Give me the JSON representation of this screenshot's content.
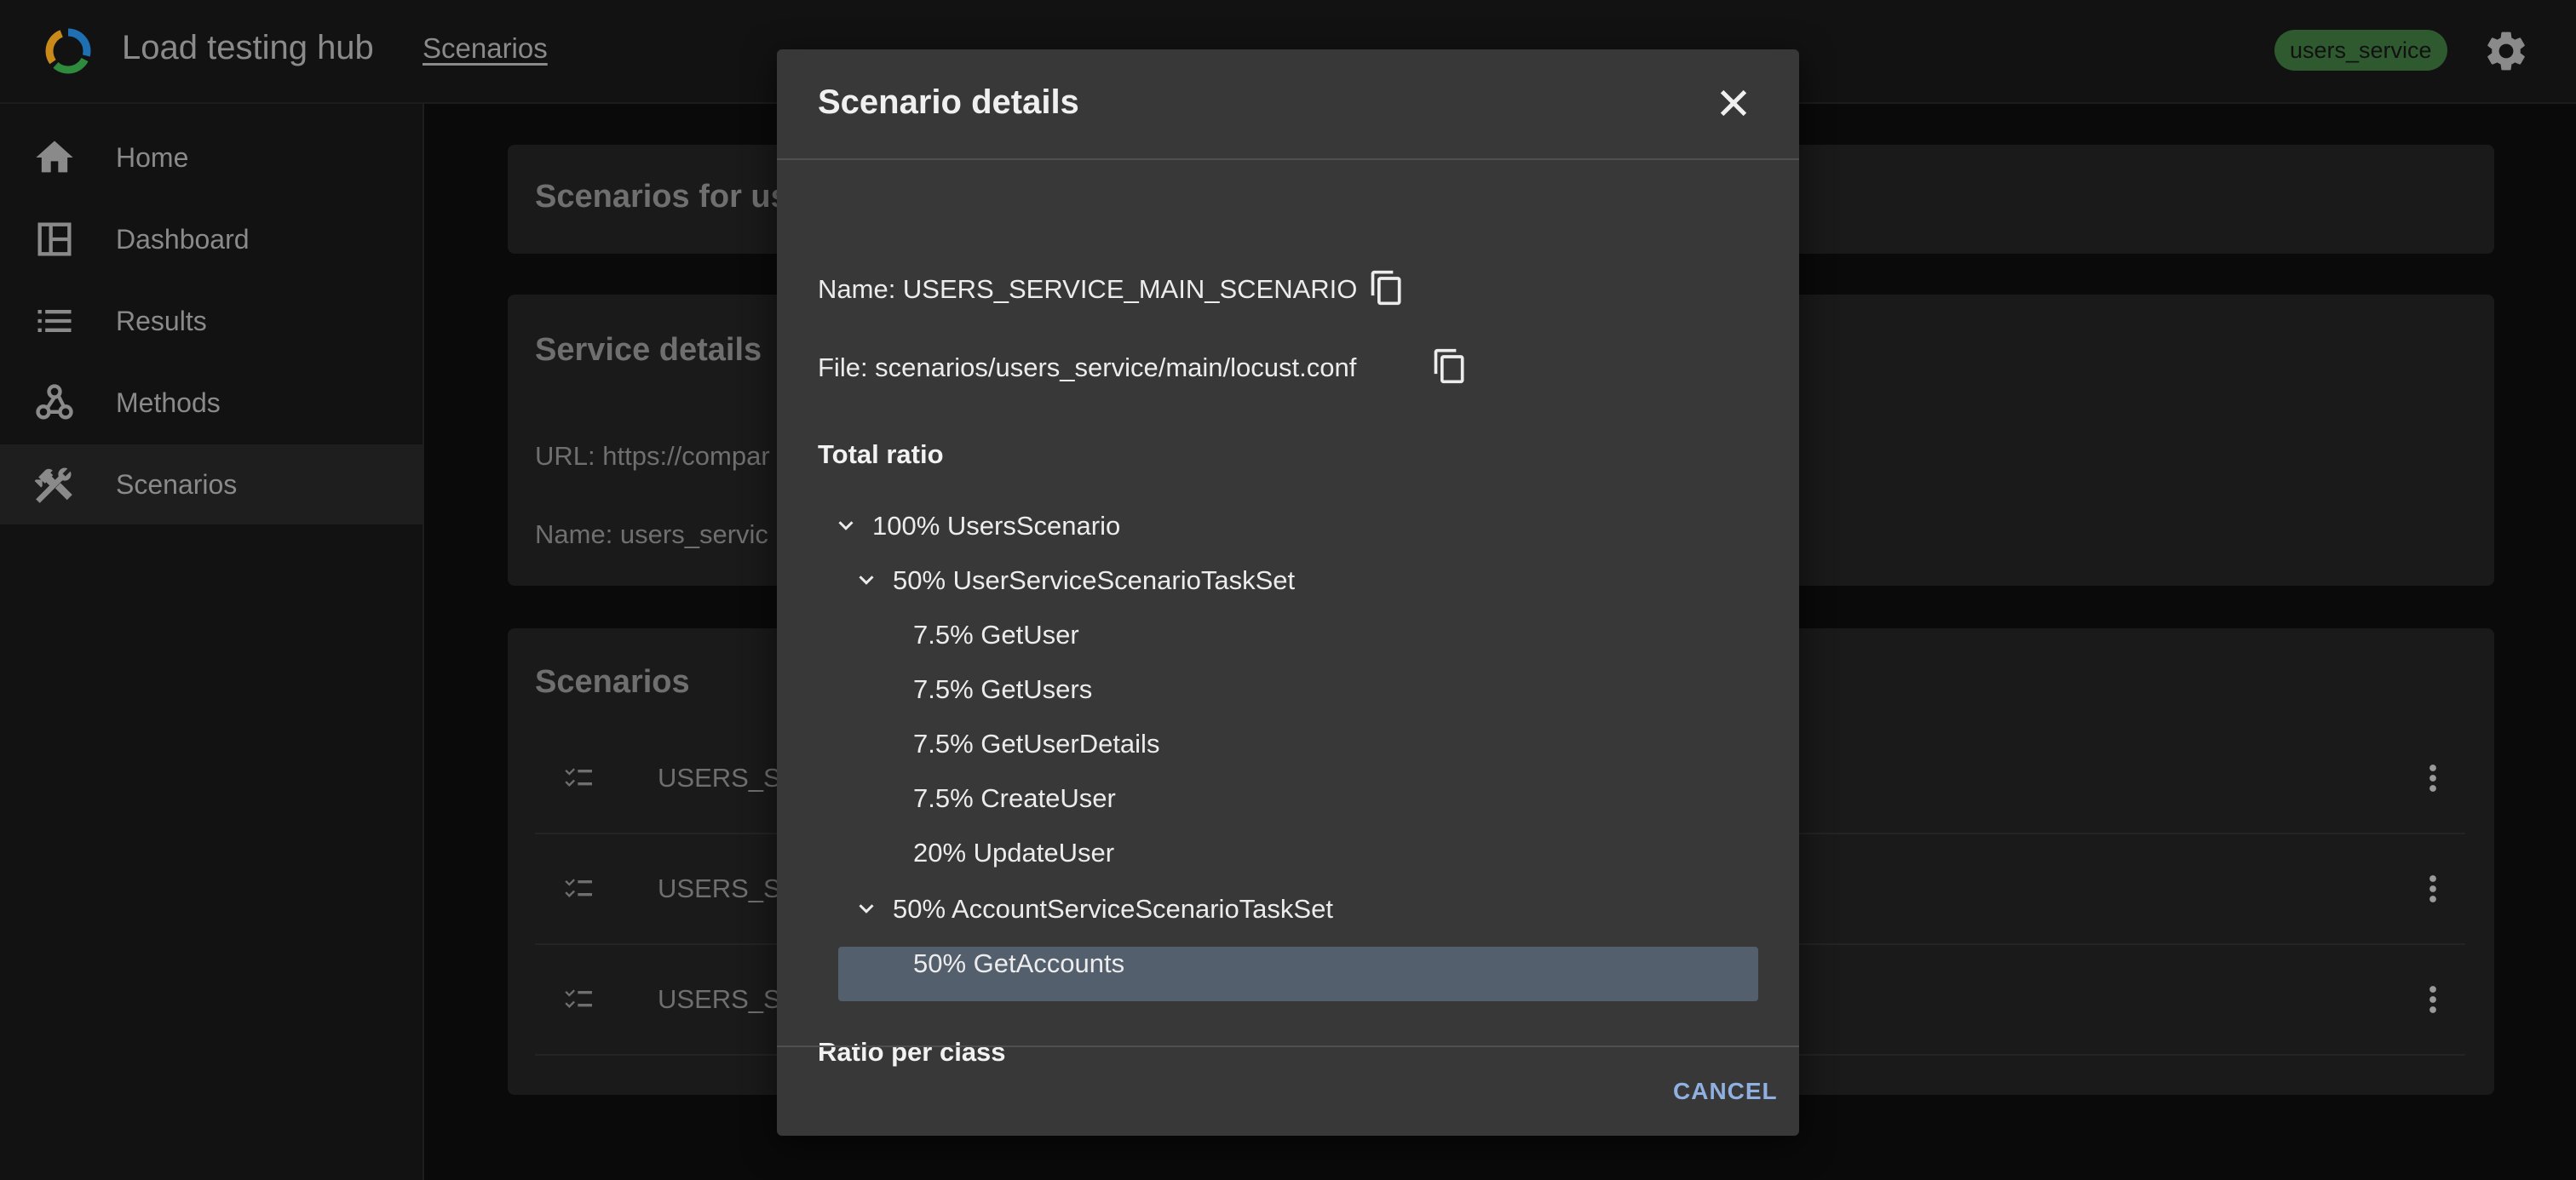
{
  "app": {
    "title": "Load testing hub",
    "breadcrumb": "Scenarios",
    "service_badge": "users_service"
  },
  "sidebar": {
    "items": [
      {
        "label": "Home",
        "icon": "home-icon"
      },
      {
        "label": "Dashboard",
        "icon": "dashboard-icon"
      },
      {
        "label": "Results",
        "icon": "list-icon"
      },
      {
        "label": "Methods",
        "icon": "webhook-icon"
      },
      {
        "label": "Scenarios",
        "icon": "tools-icon",
        "active": true
      }
    ]
  },
  "main": {
    "scenarios_header_partial": "Scenarios for us",
    "service_details": {
      "title": "Service details",
      "url_partial": "URL: https://compar",
      "name_partial": "Name: users_servic"
    },
    "scenarios_list": {
      "title": "Scenarios",
      "rows": [
        "USERS_SE",
        "USERS_SE",
        "USERS_SE"
      ]
    }
  },
  "dialog": {
    "title": "Scenario details",
    "name_line": "Name: USERS_SERVICE_MAIN_SCENARIO",
    "file_line": "File: scenarios/users_service/main/locust.conf",
    "total_ratio_title": "Total ratio",
    "tree": {
      "root": "100% UsersScenario",
      "taskset1": "50% UserServiceScenarioTaskSet",
      "taskset1_children": [
        "7.5% GetUser",
        "7.5% GetUsers",
        "7.5% GetUserDetails",
        "7.5% CreateUser",
        "20% UpdateUser"
      ],
      "taskset2": "50% AccountServiceScenarioTaskSet",
      "taskset2_children": [
        "50% GetAccounts"
      ]
    },
    "ratio_per_class_title": "Ratio per class",
    "cancel_label": "CANCEL"
  },
  "colors": {
    "accent": "#8fb0e0",
    "badge": "#2f5a2f",
    "selected_row": "#545f6d"
  }
}
